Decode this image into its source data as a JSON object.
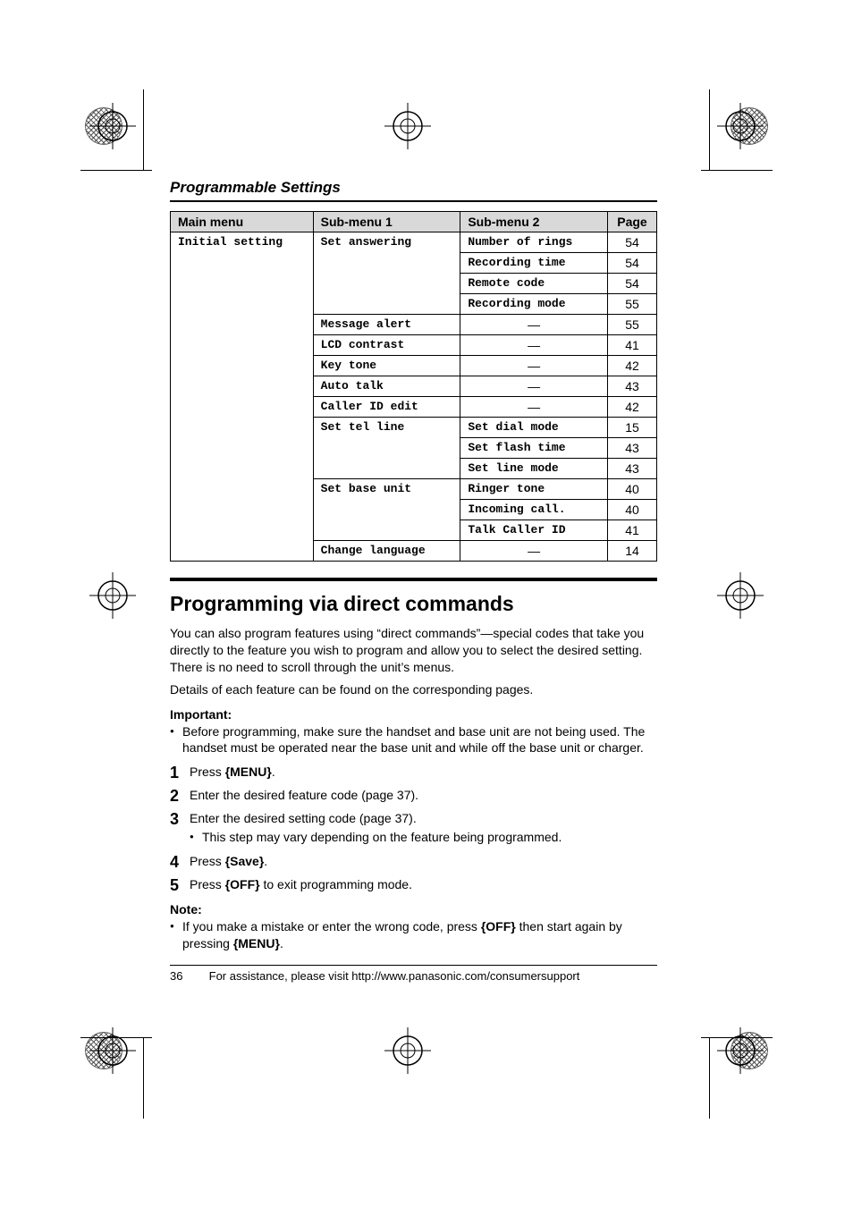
{
  "header": {
    "section_title": "Programmable Settings"
  },
  "table": {
    "headers": {
      "main": "Main menu",
      "s1": "Sub-menu 1",
      "s2": "Sub-menu 2",
      "pg": "Page"
    },
    "rows": [
      {
        "main": "Initial setting",
        "s1": "Set answering",
        "s2": "Number of rings",
        "pg": "54"
      },
      {
        "main": "",
        "s1": "",
        "s2": "Recording time",
        "pg": "54"
      },
      {
        "main": "",
        "s1": "",
        "s2": "Remote code",
        "pg": "54"
      },
      {
        "main": "",
        "s1": "",
        "s2": "Recording mode",
        "pg": "55"
      },
      {
        "main": "",
        "s1": "Message alert",
        "s2": "—",
        "pg": "55"
      },
      {
        "main": "",
        "s1": "LCD contrast",
        "s2": "—",
        "pg": "41"
      },
      {
        "main": "",
        "s1": "Key tone",
        "s2": "—",
        "pg": "42"
      },
      {
        "main": "",
        "s1": "Auto talk",
        "s2": "—",
        "pg": "43"
      },
      {
        "main": "",
        "s1": "Caller ID edit",
        "s2": "—",
        "pg": "42"
      },
      {
        "main": "",
        "s1": "Set tel line",
        "s2": "Set dial mode",
        "pg": "15"
      },
      {
        "main": "",
        "s1": "",
        "s2": "Set flash time",
        "pg": "43"
      },
      {
        "main": "",
        "s1": "",
        "s2": "Set line mode",
        "pg": "43"
      },
      {
        "main": "",
        "s1": "Set base unit",
        "s2": "Ringer tone",
        "pg": "40"
      },
      {
        "main": "",
        "s1": "",
        "s2": "Incoming call.",
        "pg": "40"
      },
      {
        "main": "",
        "s1": "",
        "s2": "Talk Caller ID",
        "pg": "41"
      },
      {
        "main": "",
        "s1": "Change language",
        "s2": "—",
        "pg": "14"
      }
    ]
  },
  "section2": {
    "heading": "Programming via direct commands",
    "para1": "You can also program features using “direct commands”—special codes that take you directly to the feature you wish to program and allow you to select the desired setting. There is no need to scroll through the unit’s menus.",
    "para2": "Details of each feature can be found on the corresponding pages.",
    "important_label": "Important:",
    "important_bullet": "Before programming, make sure the handset and base unit are not being used. The handset must be operated near the base unit and while off the base unit or charger.",
    "steps": {
      "s1_a": "Press ",
      "s1_key": "{MENU}",
      "s1_b": ".",
      "s2": "Enter the desired feature code (page 37).",
      "s3": "Enter the desired setting code (page 37).",
      "s3_sub": "This step may vary depending on the feature being programmed.",
      "s4_a": "Press ",
      "s4_key": "{Save}",
      "s4_b": ".",
      "s5_a": "Press ",
      "s5_key": "{OFF}",
      "s5_b": " to exit programming mode."
    },
    "note_label": "Note:",
    "note_a": "If you make a mistake or enter the wrong code, press ",
    "note_key1": "{OFF}",
    "note_b": " then start again by pressing ",
    "note_key2": "{MENU}",
    "note_c": "."
  },
  "footer": {
    "page_number": "36",
    "assist": "For assistance, please visit http://www.panasonic.com/consumersupport"
  }
}
